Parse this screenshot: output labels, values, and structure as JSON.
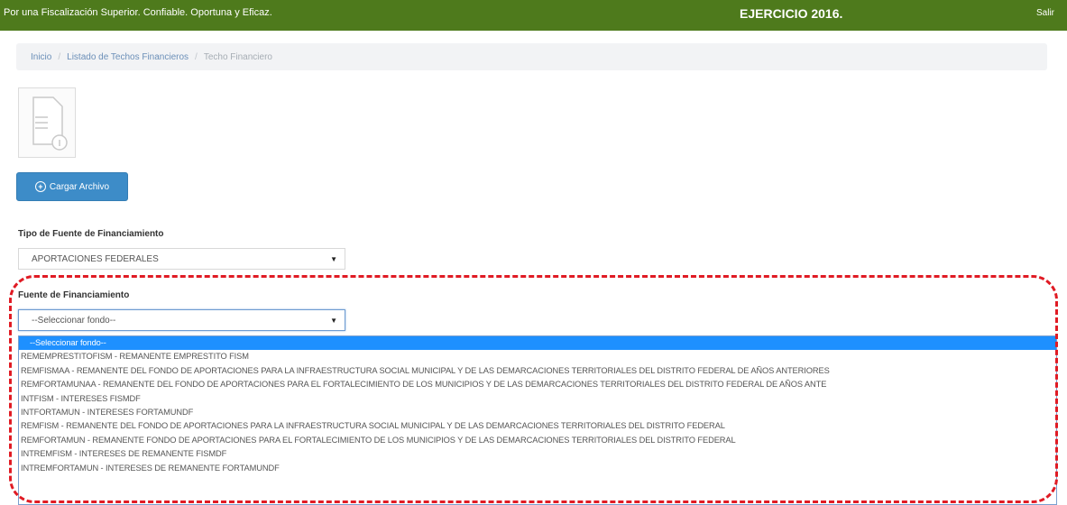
{
  "header": {
    "slogan": "Por una Fiscalización Superior. Confiable. Oportuna y Eficaz.",
    "ejercicio": "EJERCICIO 2016.",
    "salir": "Salir",
    "bg_color": "#4e7a1c"
  },
  "breadcrumb": {
    "items": [
      "Inicio",
      "Listado de Techos Financieros",
      "Techo Financiero"
    ],
    "separator": "/"
  },
  "document": {
    "icon": "document-icon"
  },
  "upload": {
    "label": "Cargar Archivo",
    "icon": "plus-circle-icon",
    "color": "#3d8cc8"
  },
  "tipo_fuente": {
    "label": "Tipo de Fuente de Financiamiento",
    "value": "APORTACIONES FEDERALES"
  },
  "fuente": {
    "label": "Fuente de Financiamiento",
    "value": "--Seleccionar fondo--",
    "options": [
      "--Seleccionar fondo--",
      "REMEMPRESTITOFISM - REMANENTE EMPRESTITO FISM",
      "REMFISMAA - REMANENTE DEL FONDO DE APORTACIONES PARA LA INFRAESTRUCTURA SOCIAL MUNICIPAL Y DE LAS DEMARCACIONES TERRITORIALES DEL DISTRITO FEDERAL DE AÑOS ANTERIORES",
      "REMFORTAMUNAA - REMANENTE DEL FONDO DE APORTACIONES PARA EL FORTALECIMIENTO DE LOS MUNICIPIOS Y DE LAS DEMARCACIONES TERRITORIALES DEL DISTRITO FEDERAL DE AÑOS ANTE",
      "INTFISM - INTERESES FISMDF",
      "INTFORTAMUN - INTERESES FORTAMUNDF",
      "REMFISM - REMANENTE DEL FONDO DE APORTACIONES PARA LA INFRAESTRUCTURA SOCIAL MUNICIPAL Y DE LAS DEMARCACIONES TERRITORIALES DEL DISTRITO FEDERAL",
      "REMFORTAMUN - REMANENTE FONDO DE APORTACIONES PARA EL FORTALECIMIENTO DE LOS MUNICIPIOS Y DE LAS DEMARCACIONES TERRITORIALES DEL DISTRITO FEDERAL",
      "INTREMFISM - INTERESES DE REMANENTE FISMDF",
      "INTREMFORTAMUN - INTERESES DE REMANENTE FORTAMUNDF"
    ],
    "selected_index": 0
  },
  "annotation": {
    "color": "#e01b24"
  }
}
